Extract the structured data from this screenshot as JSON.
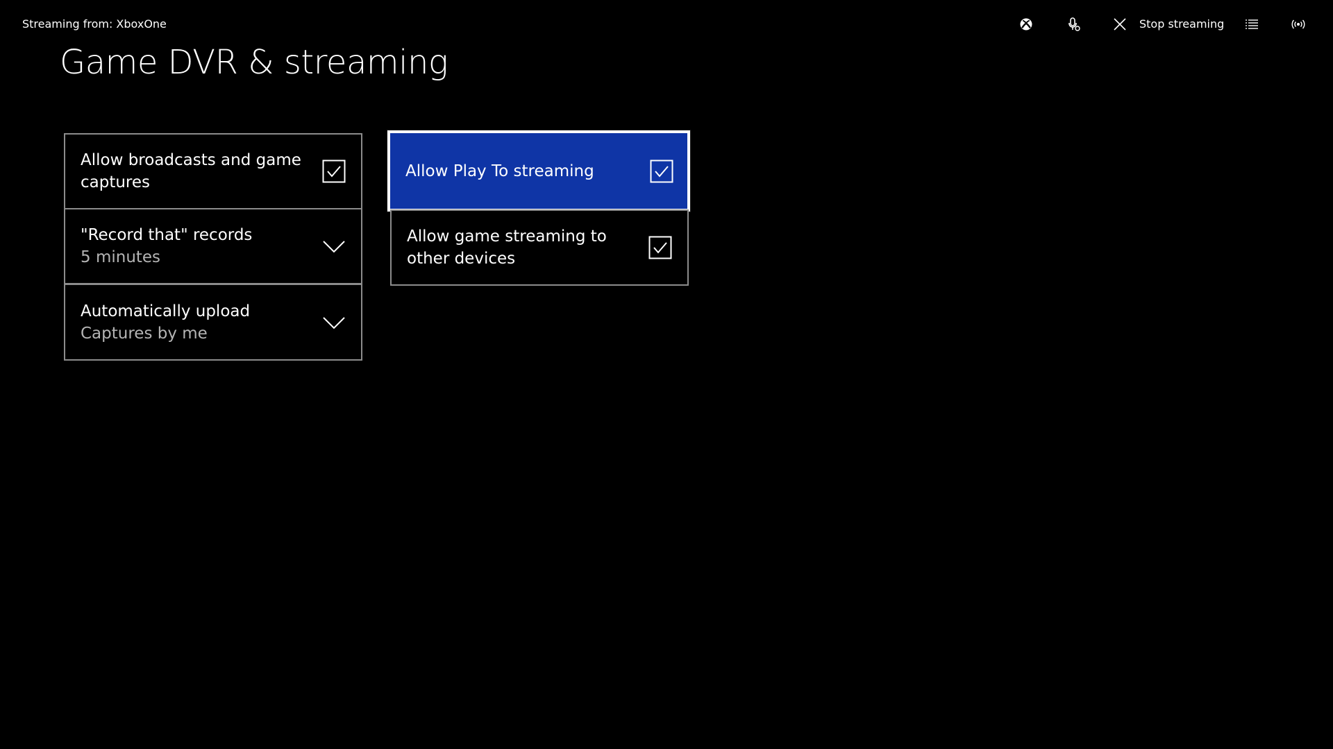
{
  "header": {
    "stream_source": "Streaming from: XboxOne",
    "stop_label": "Stop streaming",
    "icons": [
      "xbox-guide-icon",
      "kinect-icon",
      "close-icon",
      "list-icon",
      "broadcast-icon"
    ]
  },
  "page": {
    "title": "Game DVR & streaming"
  },
  "settings": {
    "broadcasts": {
      "label": "Allow broadcasts and game captures",
      "checked": true
    },
    "record_that": {
      "label": "\"Record that\" records",
      "value": "5 minutes"
    },
    "auto_upload": {
      "label": "Automatically upload",
      "value": "Captures by me"
    },
    "play_to": {
      "label": "Allow Play To streaming",
      "checked": true,
      "focused": true
    },
    "game_streaming": {
      "label": "Allow game streaming to other devices",
      "checked": true
    }
  },
  "colors": {
    "background": "#000000",
    "focus_fill": "#0f35a6",
    "tile_border": "#8c8c8c",
    "secondary_text": "#b4b4b4"
  }
}
